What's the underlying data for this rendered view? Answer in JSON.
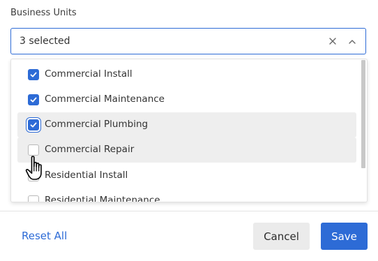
{
  "field": {
    "label": "Business Units",
    "value": "3 selected"
  },
  "dropdown": {
    "options": [
      {
        "label": "Commercial Install",
        "checked": true
      },
      {
        "label": "Commercial Maintenance",
        "checked": true
      },
      {
        "label": "Commercial Plumbing",
        "checked": true
      },
      {
        "label": "Commercial Repair",
        "checked": false
      },
      {
        "label": "Residential Install",
        "checked": false
      },
      {
        "label": "Residential Maintenance",
        "checked": false
      }
    ]
  },
  "footer": {
    "reset_label": "Reset All",
    "cancel_label": "Cancel",
    "save_label": "Save"
  },
  "colors": {
    "accent": "#2d6bd6",
    "highlight": "#eeeeee",
    "cancel_bg": "#ebebeb"
  },
  "icons": {
    "clear": "close-icon",
    "toggle": "chevron-up-icon",
    "check": "checkmark-icon",
    "cursor": "hand-pointer-icon"
  }
}
